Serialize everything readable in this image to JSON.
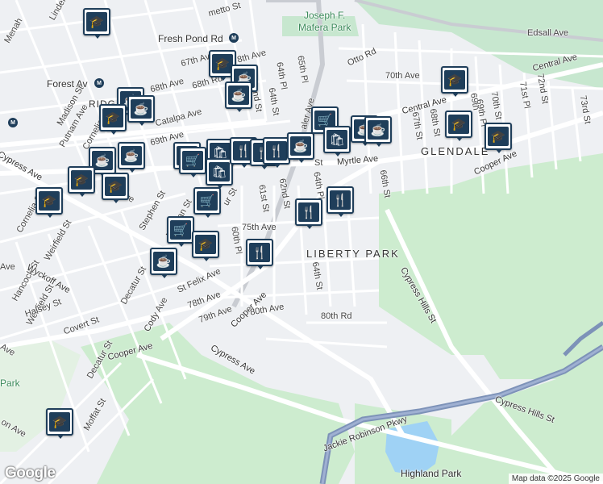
{
  "map": {
    "labels": {
      "joseph_mafera": "Joseph F.\nMafera Park",
      "fresh_pond": "Fresh Pond Rd",
      "edsall": "Edsall Ave",
      "forest_av": "Forest Av",
      "otto_rd": "Otto Rd",
      "seventieth_ave": "70th Ave",
      "central_ave_1": "Central Ave",
      "central_ave_2": "Central Ave",
      "glendale": "GLENDALE",
      "liberty_park": "LIBERTY PARK",
      "myrtle": "Myrtle Ave",
      "cooper_ave_1": "Cooper Ave",
      "cooper_ave_2": "Cooper Ave",
      "cooper_ave_3": "Cooper Ave",
      "cypress_hills_st_1": "Cypress Hills St",
      "cypress_hills_st_2": "Cypress Hills St",
      "cypress_ave_1": "Cypress Ave",
      "cypress_ave_2": "Cypress Ave",
      "jackie_robinson": "Jackie Robinson Pkwy",
      "highland_park": "Highland Park",
      "park": "Park",
      "st_67_ave": "67th Ave",
      "st_68_ave": "68th Ave",
      "st_68_rd": "68th Rd",
      "st_69_ave": "69th Ave",
      "catalpa": "Catalpa Ave",
      "madison": "Madison St",
      "putnam": "Putnam Ave",
      "cornelia_1": "Cornelia St",
      "cornelia_2": "Cornelia St",
      "ridg": "RIDG",
      "menahan": "Menah",
      "linden": "Linden",
      "palmetto": "metto St",
      "eighth_ave": "8th Ave",
      "st_64_pl": "64th Pl",
      "st_65_pl": "65th Pl",
      "st_64_st": "64th St",
      "st_65_st": "nd St",
      "st_66_st": "66th St",
      "st_67_st": "67th St",
      "st_68_st": "68th St",
      "st_69_st": "69th",
      "st_70_st": "70th St",
      "st_71_st": "71st Pl",
      "st_72_st": "72nd St",
      "st_73_st": "73rd St",
      "st_69_pl": "69th Pl",
      "fifth_pl": "5th Pl",
      "st_61_st": "61st St",
      "st_62_st": "62nd St",
      "st_64_st_2": "64th St",
      "st_64_pl_2": "64th Pl",
      "st_60_pl": "60th Pl",
      "st_75_ave": "75th Ave",
      "st_78_ave": "78th Ave",
      "st_79_ave": "79th Ave",
      "st_80_ave": "80th Ave",
      "st_80_rd": "80th Rd",
      "st_felix": "St Felix Ave",
      "norman": "Norman St",
      "stephen": "Stephen St",
      "weirfield_1": "Weirfield St",
      "weirfield_2": "Weirfield St",
      "hancock": "Hancock St",
      "wyckoff": "Wyckoff Ave",
      "halsey": "Halsey St",
      "covert": "Covert St",
      "decatur_1": "Decatur St",
      "decatur_2": "Decatur St",
      "cody": "Cody Ave",
      "moffat": "Moffat St",
      "ave_left": "Ave",
      "ave_left2": "Ave",
      "ave_left3": "on Ave",
      "cypress_left": "Cypress Ave",
      "ur_st": "ur St",
      "st_suffix": "St",
      "aler_ave": "aler Ave",
      "myrtle_prefix": "St",
      "ave_stephen": "Ave"
    },
    "pins": [
      {
        "type": "school",
        "icon": "school-icon"
      },
      {
        "type": "school",
        "icon": "school-icon"
      },
      {
        "type": "cafe",
        "icon": "cafe-icon"
      },
      {
        "type": "cafe",
        "icon": "cafe-icon"
      },
      {
        "type": "cafe",
        "icon": "cafe-icon"
      },
      {
        "type": "school",
        "icon": "school-icon"
      },
      {
        "type": "cafe",
        "icon": "cafe-icon"
      },
      {
        "type": "cafe",
        "icon": "cafe-icon"
      },
      {
        "type": "school",
        "icon": "school-icon"
      },
      {
        "type": "school",
        "icon": "school-icon"
      },
      {
        "type": "school",
        "icon": "school-icon"
      },
      {
        "type": "grocery",
        "icon": "cart-icon"
      },
      {
        "type": "grocery",
        "icon": "cart-icon"
      },
      {
        "type": "shopping",
        "icon": "shopping-bag-icon"
      },
      {
        "type": "shopping",
        "icon": "shopping-bag-icon"
      },
      {
        "type": "restaurant",
        "icon": "restaurant-icon"
      },
      {
        "type": "restaurant",
        "icon": "restaurant-icon"
      },
      {
        "type": "cafe",
        "icon": "cafe-icon"
      },
      {
        "type": "grocery",
        "icon": "cart-icon"
      },
      {
        "type": "shopping",
        "icon": "shopping-bag-icon"
      },
      {
        "type": "cafe",
        "icon": "cafe-icon"
      },
      {
        "type": "school",
        "icon": "school-icon"
      },
      {
        "type": "school",
        "icon": "school-icon"
      },
      {
        "type": "school",
        "icon": "school-icon"
      },
      {
        "type": "restaurant",
        "icon": "restaurant-icon"
      },
      {
        "type": "restaurant",
        "icon": "restaurant-icon"
      },
      {
        "type": "grocery",
        "icon": "cart-icon"
      },
      {
        "type": "grocery",
        "icon": "cart-icon"
      },
      {
        "type": "school",
        "icon": "school-icon"
      },
      {
        "type": "cafe",
        "icon": "cafe-icon"
      },
      {
        "type": "restaurant",
        "icon": "restaurant-icon"
      },
      {
        "type": "school",
        "icon": "school-icon"
      }
    ],
    "colors": {
      "pin": "#1f3e5a",
      "park": "#c8e6c9",
      "water": "#9fd2f5",
      "highway": "#7d92b8",
      "road": "#ffffff"
    }
  },
  "footer": {
    "google": "Google",
    "credit": "Map data ©2025 Google"
  }
}
